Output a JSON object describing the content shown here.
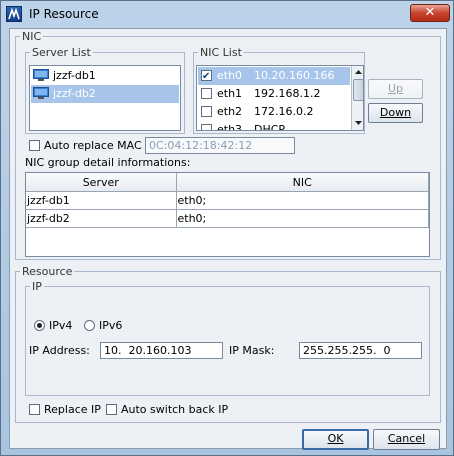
{
  "window": {
    "title": "IP Resource",
    "close_glyph": "✕"
  },
  "nic_group": {
    "legend": "NIC",
    "server_list": {
      "legend": "Server List",
      "items": [
        {
          "label": "jzzf-db1",
          "selected": false
        },
        {
          "label": "jzzf-db2",
          "selected": true
        }
      ]
    },
    "nic_list": {
      "legend": "NIC List",
      "rows": [
        {
          "name": "eth0",
          "ip": "10.20.160.166",
          "checked": true,
          "selected": true
        },
        {
          "name": "eth1",
          "ip": "192.168.1.2",
          "checked": false,
          "selected": false
        },
        {
          "name": "eth2",
          "ip": "172.16.0.2",
          "checked": false,
          "selected": false
        },
        {
          "name": "eth3",
          "ip": "DHCP",
          "checked": false,
          "selected": false
        }
      ],
      "check_glyph": "✔"
    },
    "up_button": "Up",
    "down_button": "Down",
    "auto_replace_mac": {
      "label": "Auto replace MAC",
      "value": "0C:04:12:18:42:12"
    },
    "detail_label": "NIC group detail informations:",
    "detail_table": {
      "columns": [
        "Server",
        "NIC"
      ],
      "rows": [
        [
          "jzzf-db1",
          "eth0;"
        ],
        [
          "jzzf-db2",
          "eth0;"
        ]
      ]
    }
  },
  "resource_group": {
    "legend": "Resource",
    "ip_group": {
      "legend": "IP",
      "ipv4_label": "IPv4",
      "ipv6_label": "IPv6",
      "selected": "IPv4",
      "ip_address_label": "IP Address:",
      "ip_address_value": "10.  20.160.103",
      "ip_mask_label": "IP Mask:",
      "ip_mask_value": "255.255.255.  0"
    },
    "replace_ip_label": "Replace IP",
    "auto_switch_back_label": "Auto switch back IP"
  },
  "footer": {
    "ok_label": "OK",
    "cancel_label": "Cancel"
  }
}
